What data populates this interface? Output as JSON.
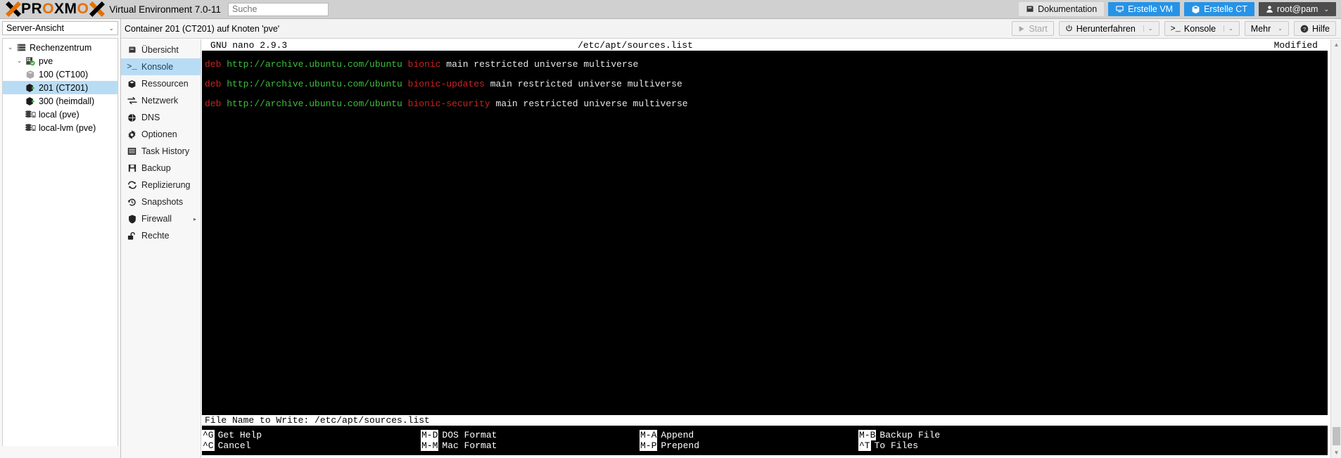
{
  "header": {
    "brand": "PROXMOX",
    "env_title": "Virtual Environment 7.0-11",
    "search": {
      "placeholder": "Suche",
      "value": ""
    },
    "buttons": [
      {
        "label": "Dokumentation",
        "icon": "book-icon",
        "style": "grey"
      },
      {
        "label": "Erstelle VM",
        "icon": "monitor-icon",
        "style": "blue"
      },
      {
        "label": "Erstelle CT",
        "icon": "container-icon",
        "style": "blue"
      },
      {
        "label": "root@pam",
        "icon": "user-icon",
        "style": "grey",
        "chevron": "⌄"
      }
    ]
  },
  "sidebar": {
    "view_select": {
      "label": "Server-Ansicht",
      "chevron": "⌄"
    },
    "tree": [
      {
        "label": "Rechenzentrum",
        "icon": "datacenter-icon",
        "level": 1,
        "arrow": "⌄",
        "selected": false
      },
      {
        "label": "pve",
        "icon": "node-icon",
        "level": 2,
        "arrow": "⌄",
        "selected": false
      },
      {
        "label": "100 (CT100)",
        "icon": "container-stopped-icon",
        "level": 3,
        "arrow": "",
        "selected": false
      },
      {
        "label": "201 (CT201)",
        "icon": "container-running-icon",
        "level": 3,
        "arrow": "",
        "selected": true
      },
      {
        "label": "300 (heimdall)",
        "icon": "container-running-icon",
        "level": 3,
        "arrow": "",
        "selected": false
      },
      {
        "label": "local (pve)",
        "icon": "storage-icon",
        "level": 3,
        "arrow": "",
        "selected": false
      },
      {
        "label": "local-lvm (pve)",
        "icon": "storage-icon",
        "level": 3,
        "arrow": "",
        "selected": false
      }
    ]
  },
  "breadcrumb": {
    "text": "Container 201 (CT201) auf Knoten 'pve'"
  },
  "toolbar": {
    "start": {
      "label": "Start",
      "icon": "play-icon",
      "disabled": true
    },
    "shutdown": {
      "label": "Herunterfahren",
      "icon": "power-icon",
      "chevron": "⌄"
    },
    "console": {
      "label": "Konsole",
      "icon": "prompt-icon",
      "chevron": "⌄"
    },
    "more": {
      "label": "Mehr",
      "chevron": "⌄"
    },
    "help": {
      "label": "Hilfe",
      "icon": "question-icon"
    }
  },
  "nav": {
    "items": [
      {
        "label": "Übersicht",
        "icon": "book-icon",
        "active": false
      },
      {
        "label": "Konsole",
        "icon": "prompt-icon",
        "active": true
      },
      {
        "label": "Ressourcen",
        "icon": "container-icon",
        "active": false
      },
      {
        "label": "Netzwerk",
        "icon": "network-icon",
        "active": false
      },
      {
        "label": "DNS",
        "icon": "globe-icon",
        "active": false
      },
      {
        "label": "Optionen",
        "icon": "gear-icon",
        "active": false
      },
      {
        "label": "Task History",
        "icon": "list-icon",
        "active": false
      },
      {
        "label": "Backup",
        "icon": "save-icon",
        "active": false
      },
      {
        "label": "Replizierung",
        "icon": "replicate-icon",
        "active": false
      },
      {
        "label": "Snapshots",
        "icon": "history-icon",
        "active": false
      },
      {
        "label": "Firewall",
        "icon": "shield-icon",
        "active": false,
        "submenu": "▸"
      },
      {
        "label": "Rechte",
        "icon": "lock-icon",
        "active": false
      }
    ]
  },
  "terminal": {
    "nano": {
      "version_label": "GNU nano 2.9.3",
      "file_label": "/etc/apt/sources.list",
      "status_label": "Modified"
    },
    "lines": [
      {
        "deb": "deb",
        "url": "http://archive.ubuntu.com/ubuntu",
        "suite": "bionic",
        "components": "main restricted universe multiverse"
      },
      {
        "deb": "deb",
        "url": "http://archive.ubuntu.com/ubuntu",
        "suite": "bionic-updates",
        "components": "main restricted universe multiverse"
      },
      {
        "deb": "deb",
        "url": "http://archive.ubuntu.com/ubuntu",
        "suite": "bionic-security",
        "components": "main restricted universe multiverse"
      }
    ],
    "prompt": "File Name to Write: /etc/apt/sources.list",
    "shortcuts_row1": [
      {
        "key": "^G",
        "label": "Get Help"
      },
      {
        "key": "M-D",
        "label": "DOS Format"
      },
      {
        "key": "M-A",
        "label": "Append"
      },
      {
        "key": "M-B",
        "label": "Backup File"
      }
    ],
    "shortcuts_row2": [
      {
        "key": "^C",
        "label": "Cancel"
      },
      {
        "key": "M-M",
        "label": "Mac Format"
      },
      {
        "key": "M-P",
        "label": "Prepend"
      },
      {
        "key": "^T",
        "label": "To Files"
      }
    ],
    "colors": {
      "deb": "#cc2222",
      "url": "#3bbf3b",
      "suite": "#cc2222",
      "components": "#e8e8e8",
      "background": "#000000"
    }
  }
}
